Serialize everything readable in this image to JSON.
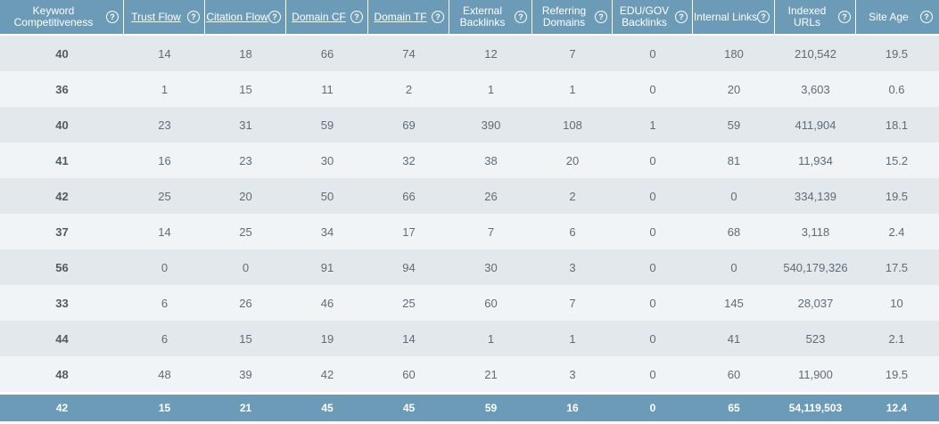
{
  "headers": [
    {
      "label": "Keyword Competitiveness",
      "link": false
    },
    {
      "label": "Trust Flow",
      "link": true
    },
    {
      "label": "Citation Flow",
      "link": true
    },
    {
      "label": "Domain CF",
      "link": true
    },
    {
      "label": "Domain TF",
      "link": true
    },
    {
      "label": "External Backlinks",
      "link": false
    },
    {
      "label": "Referring Domains",
      "link": false
    },
    {
      "label": "EDU/GOV Backlinks",
      "link": false
    },
    {
      "label": "Internal Links",
      "link": false
    },
    {
      "label": "Indexed URLs",
      "link": false
    },
    {
      "label": "Site Age",
      "link": false
    }
  ],
  "help_icon_glyph": "?",
  "rows": [
    [
      "40",
      "14",
      "18",
      "66",
      "74",
      "12",
      "7",
      "0",
      "180",
      "210,542",
      "19.5"
    ],
    [
      "36",
      "1",
      "15",
      "11",
      "2",
      "1",
      "1",
      "0",
      "20",
      "3,603",
      "0.6"
    ],
    [
      "40",
      "23",
      "31",
      "59",
      "69",
      "390",
      "108",
      "1",
      "59",
      "411,904",
      "18.1"
    ],
    [
      "41",
      "16",
      "23",
      "30",
      "32",
      "38",
      "20",
      "0",
      "81",
      "11,934",
      "15.2"
    ],
    [
      "42",
      "25",
      "20",
      "50",
      "66",
      "26",
      "2",
      "0",
      "0",
      "334,139",
      "19.5"
    ],
    [
      "37",
      "14",
      "25",
      "34",
      "17",
      "7",
      "6",
      "0",
      "68",
      "3,118",
      "2.4"
    ],
    [
      "56",
      "0",
      "0",
      "91",
      "94",
      "30",
      "3",
      "0",
      "0",
      "540,179,326",
      "17.5"
    ],
    [
      "33",
      "6",
      "26",
      "46",
      "25",
      "60",
      "7",
      "0",
      "145",
      "28,037",
      "10"
    ],
    [
      "44",
      "6",
      "15",
      "19",
      "14",
      "1",
      "1",
      "0",
      "41",
      "523",
      "2.1"
    ],
    [
      "48",
      "48",
      "39",
      "42",
      "60",
      "21",
      "3",
      "0",
      "60",
      "11,900",
      "19.5"
    ]
  ],
  "totals": [
    "42",
    "15",
    "21",
    "45",
    "45",
    "59",
    "16",
    "0",
    "65",
    "54,119,503",
    "12.4"
  ],
  "colors": {
    "header_bg": "#6c9bb8",
    "row_odd": "#e3e8ed",
    "row_even": "#f1f4f7",
    "text": "#5e6c77"
  }
}
